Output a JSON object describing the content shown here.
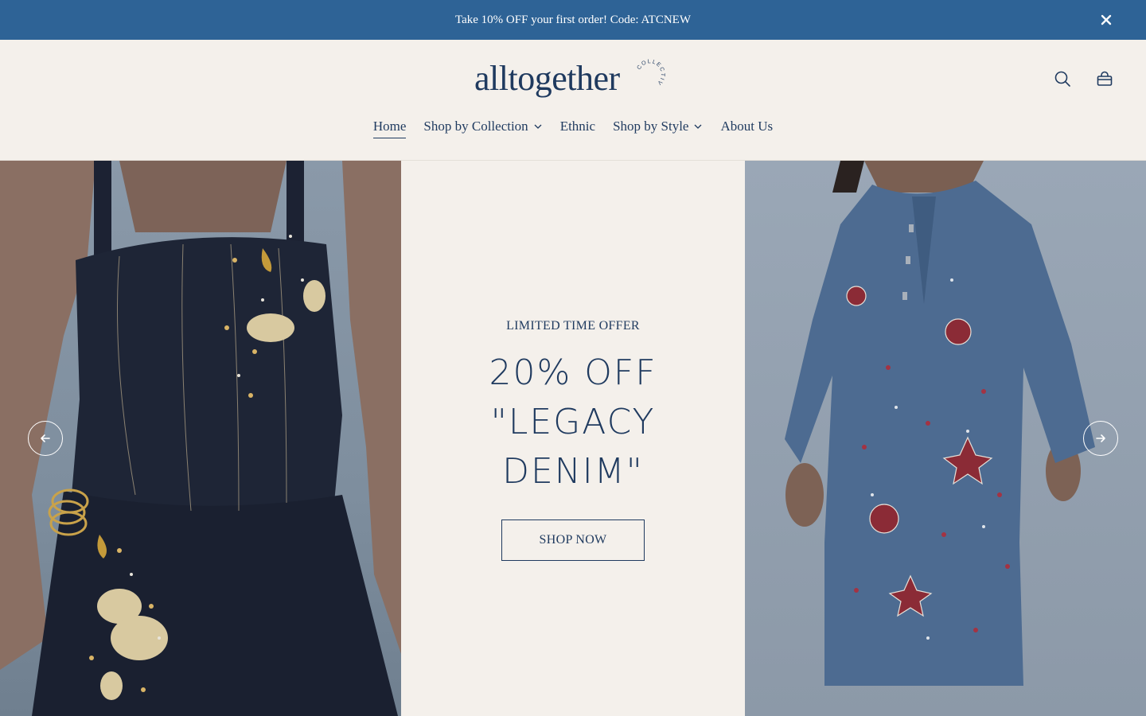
{
  "announcement": {
    "text": "Take 10% OFF your first order! Code: ATCNEW",
    "close_icon": "close-icon"
  },
  "header": {
    "logo_text": "alltogether",
    "logo_subtext": "COLLECTIVE",
    "icons": [
      "search-icon",
      "bag-icon"
    ],
    "nav": [
      {
        "label": "Home",
        "active": true,
        "dropdown": false
      },
      {
        "label": "Shop by Collection",
        "active": false,
        "dropdown": true
      },
      {
        "label": "Ethnic",
        "active": false,
        "dropdown": false
      },
      {
        "label": "Shop by Style",
        "active": false,
        "dropdown": true
      },
      {
        "label": "About Us",
        "active": false,
        "dropdown": false
      }
    ]
  },
  "hero": {
    "eyebrow": "LIMITED TIME OFFER",
    "headline": "20% OFF \"LEGACY DENIM\"",
    "cta_label": "SHOP NOW",
    "prev_icon": "arrow-left-icon",
    "next_icon": "arrow-right-icon"
  },
  "colors": {
    "announcement_bg": "#2e6396",
    "brand_navy": "#1f3a5f",
    "page_bg": "#f4f0eb"
  }
}
